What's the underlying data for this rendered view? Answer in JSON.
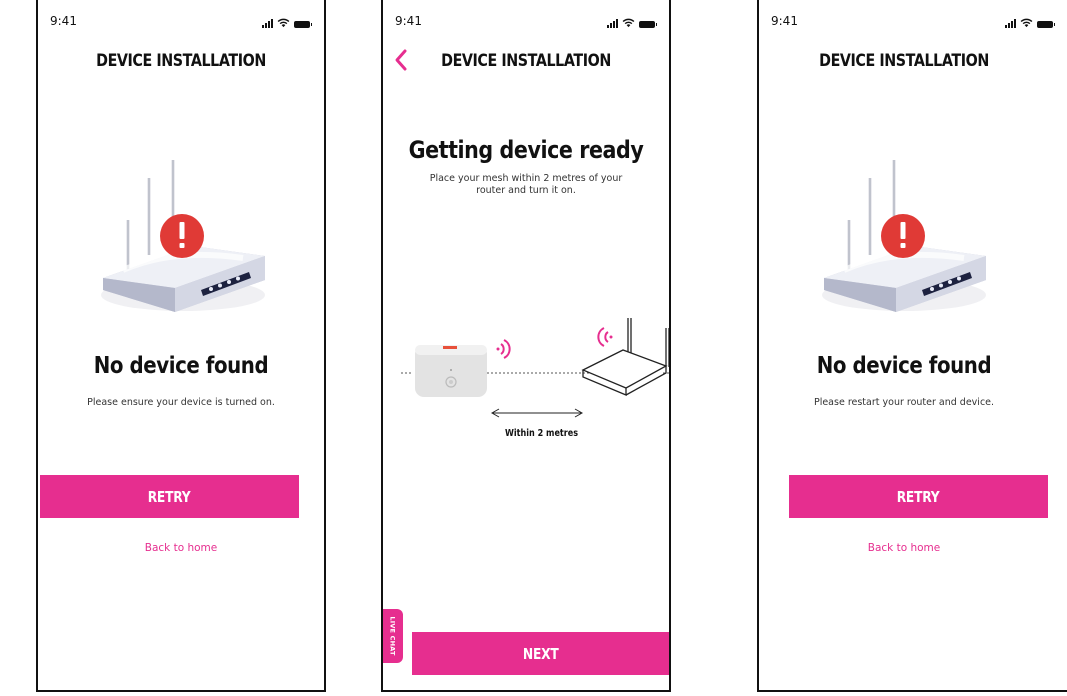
{
  "status_bar": {
    "time": "9:41"
  },
  "screens": [
    {
      "header_title": "DEVICE INSTALLATION",
      "heading": "No device found",
      "message": "Please ensure your device is turned on.",
      "primary_button": "RETRY",
      "secondary_link": "Back to home"
    },
    {
      "header_title": "DEVICE INSTALLATION",
      "heading": "Getting device ready",
      "message_line1": "Place your mesh within 2 metres of your",
      "message_line2": "router and turn it on.",
      "diagram_label": "Within 2 metres",
      "live_chat_label": "LIVE CHAT",
      "primary_button": "NEXT"
    },
    {
      "header_title": "DEVICE INSTALLATION",
      "heading": "No device found",
      "message": "Please restart your router and device.",
      "primary_button": "RETRY",
      "secondary_link": "Back to home"
    }
  ],
  "icons": {
    "back": "chevron-left-icon",
    "error": "exclamation-alert-icon",
    "signal": "cellular-signal-icon",
    "wifi": "wifi-icon",
    "battery": "battery-icon"
  },
  "colors": {
    "accent": "#e62e8f",
    "error": "#e03a36",
    "text": "#111111",
    "router_body": "#e6e8f0"
  }
}
